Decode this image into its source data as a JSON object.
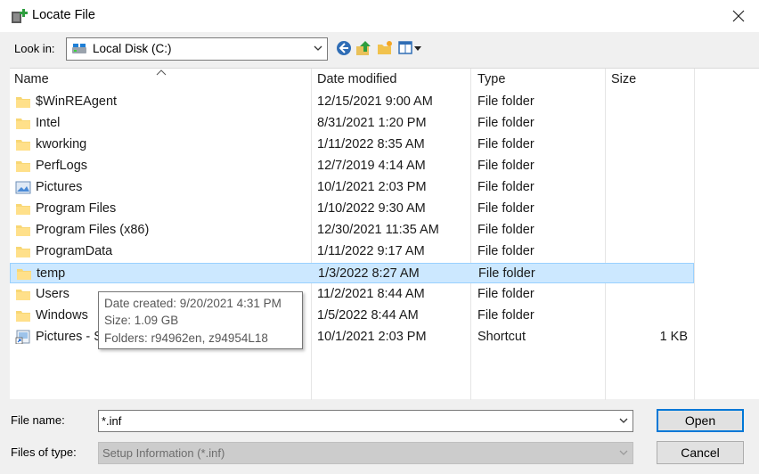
{
  "window": {
    "title": "Locate File"
  },
  "lookin": {
    "label": "Look in:",
    "value": "Local Disk (C:)"
  },
  "toolbar": {
    "back_icon": "back-arrow-icon",
    "up_icon": "up-folder-icon",
    "new_folder_icon": "new-folder-icon",
    "view_icon": "view-menu-icon"
  },
  "columns": {
    "name": "Name",
    "date": "Date modified",
    "type": "Type",
    "size": "Size"
  },
  "files": [
    {
      "name": "$WinREAgent",
      "date": "12/15/2021 9:00 AM",
      "type": "File folder",
      "size": "",
      "icon": "folder-icon"
    },
    {
      "name": "Intel",
      "date": "8/31/2021 1:20 PM",
      "type": "File folder",
      "size": "",
      "icon": "folder-icon"
    },
    {
      "name": "kworking",
      "date": "1/11/2022 8:35 AM",
      "type": "File folder",
      "size": "",
      "icon": "folder-icon"
    },
    {
      "name": "PerfLogs",
      "date": "12/7/2019 4:14 AM",
      "type": "File folder",
      "size": "",
      "icon": "folder-icon"
    },
    {
      "name": "Pictures",
      "date": "10/1/2021 2:03 PM",
      "type": "File folder",
      "size": "",
      "icon": "pictures-folder-icon"
    },
    {
      "name": "Program Files",
      "date": "1/10/2022 9:30 AM",
      "type": "File folder",
      "size": "",
      "icon": "folder-icon"
    },
    {
      "name": "Program Files (x86)",
      "date": "12/30/2021 11:35 AM",
      "type": "File folder",
      "size": "",
      "icon": "folder-icon"
    },
    {
      "name": "ProgramData",
      "date": "1/11/2022 9:17 AM",
      "type": "File folder",
      "size": "",
      "icon": "folder-icon"
    },
    {
      "name": "temp",
      "date": "1/3/2022 8:27 AM",
      "type": "File folder",
      "size": "",
      "icon": "folder-icon",
      "selected": true
    },
    {
      "name": "Users",
      "date": "11/2/2021 8:44 AM",
      "type": "File folder",
      "size": "",
      "icon": "folder-icon"
    },
    {
      "name": "Windows",
      "date": "1/5/2022 8:44 AM",
      "type": "File folder",
      "size": "",
      "icon": "folder-icon"
    },
    {
      "name": "Pictures - S",
      "date": "10/1/2021 2:03 PM",
      "type": "Shortcut",
      "size": "1 KB",
      "icon": "shortcut-icon"
    }
  ],
  "tooltip": {
    "created": "Date created: 9/20/2021 4:31 PM",
    "size": "Size: 1.09 GB",
    "folders": "Folders: r94962en, z94954L18"
  },
  "filename": {
    "label": "File name:",
    "value": "*.inf"
  },
  "filetype": {
    "label": "Files of type:",
    "value": "Setup Information (*.inf)"
  },
  "buttons": {
    "open": "Open",
    "cancel": "Cancel"
  },
  "colors": {
    "selection": "#cce8ff",
    "selection_border": "#99d1ff",
    "accent": "#0078d7",
    "folder": "#f8d775"
  }
}
